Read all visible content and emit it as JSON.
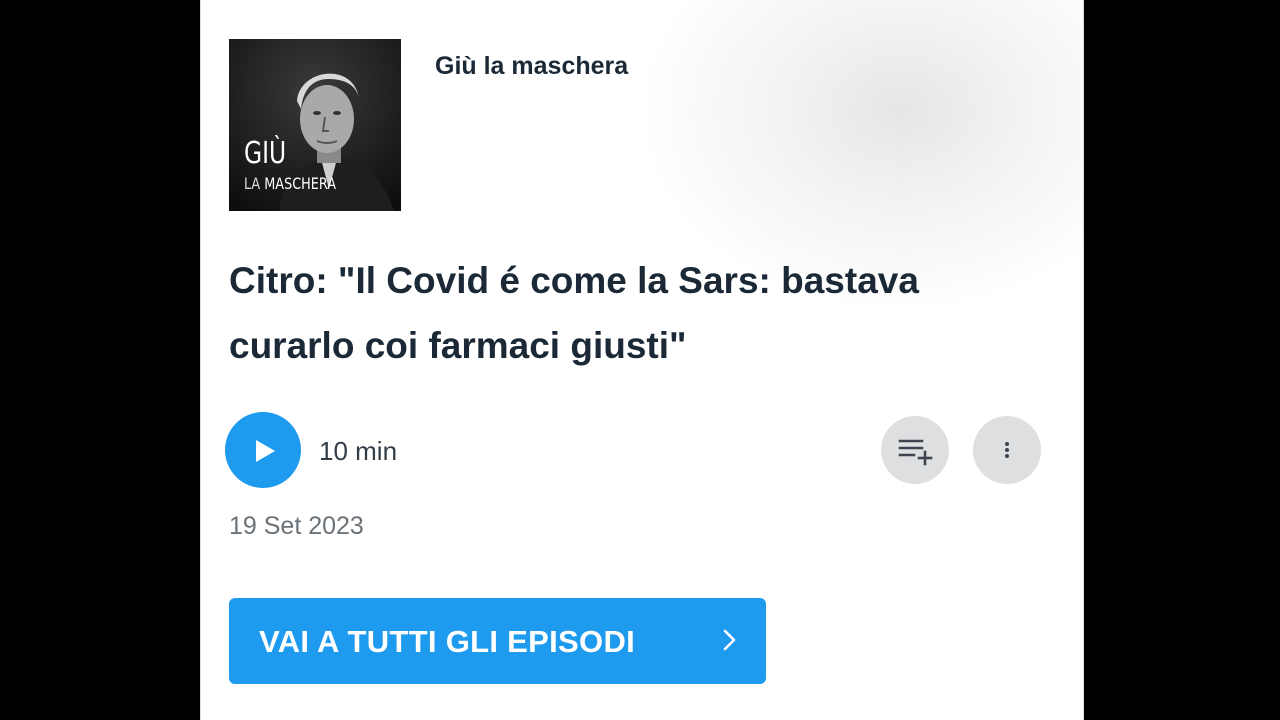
{
  "podcast": {
    "name": "Giù la maschera",
    "cover_title": "GIÙ",
    "cover_sub_la": "LA",
    "cover_sub_maschera": "MASCHERA"
  },
  "episode": {
    "title": "Citro: \"Il Covid é come la Sars: bastava curarlo coi farmaci giusti\"",
    "duration": "10 min",
    "date": "19 Set 2023"
  },
  "actions": {
    "play_icon": "play-icon",
    "queue_icon": "add-to-queue-icon",
    "more_icon": "more-vertical-icon"
  },
  "cta": {
    "label": "VAI A TUTTI GLI EPISODI",
    "icon": "chevron-right-icon"
  },
  "colors": {
    "accent": "#1e9aee",
    "title_text": "#1b2836",
    "muted_text": "#6b7278",
    "icon_button_bg": "#dedfe1"
  }
}
